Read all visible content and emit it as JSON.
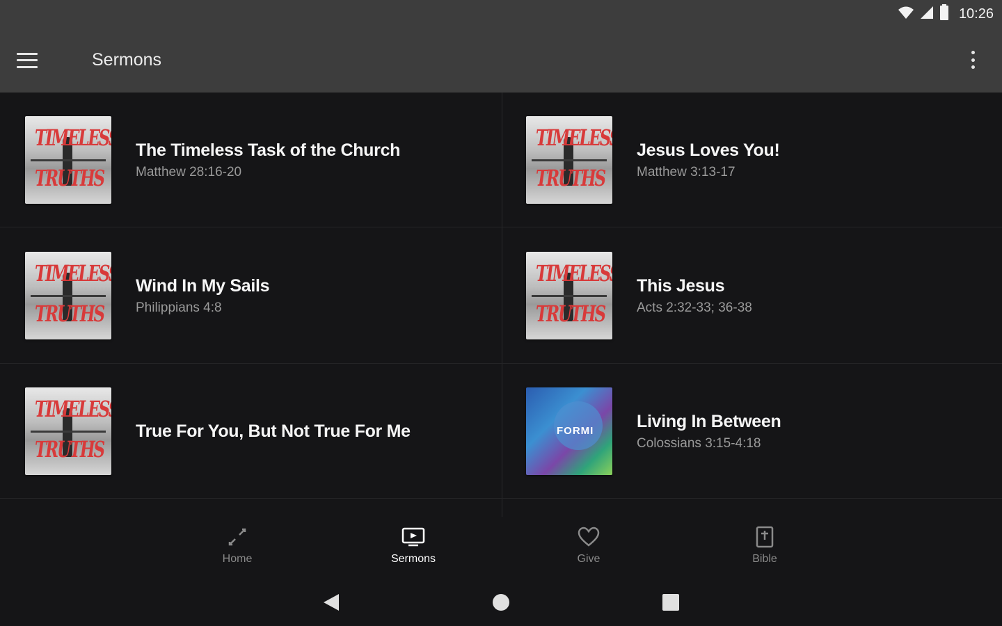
{
  "status": {
    "time": "10:26",
    "icons": [
      "wifi-icon",
      "signal-icon",
      "battery-icon"
    ]
  },
  "appbar": {
    "title": "Sermons",
    "menu_icon": "menu-icon",
    "overflow_icon": "more-vert-icon"
  },
  "sermons": [
    {
      "title": "The Timeless Task of the Church",
      "reference": "Matthew 28:16-20",
      "artwork": "timeless-truths"
    },
    {
      "title": "Jesus Loves You!",
      "reference": "Matthew 3:13-17",
      "artwork": "timeless-truths"
    },
    {
      "title": "Wind In My Sails",
      "reference": "Philippians 4:8",
      "artwork": "timeless-truths"
    },
    {
      "title": "This Jesus",
      "reference": "Acts 2:32-33; 36-38",
      "artwork": "timeless-truths"
    },
    {
      "title": "True For You, But Not True For Me",
      "reference": "",
      "artwork": "timeless-truths"
    },
    {
      "title": "Living In Between",
      "reference": "Colossians 3:15-4:18",
      "artwork": "formed"
    }
  ],
  "artwork_text": {
    "timeless_top": "TIMELESS",
    "timeless_bottom": "TRUTHS",
    "formed": "FORMI"
  },
  "bottom_nav": [
    {
      "label": "Home",
      "icon": "home-icon",
      "active": false
    },
    {
      "label": "Sermons",
      "icon": "tv-play-icon",
      "active": true
    },
    {
      "label": "Give",
      "icon": "heart-icon",
      "active": false
    },
    {
      "label": "Bible",
      "icon": "bible-icon",
      "active": false
    }
  ],
  "system_nav": [
    "back-icon",
    "home-circle-icon",
    "recents-icon"
  ],
  "colors": {
    "background": "#151517",
    "appbar": "#3d3d3d",
    "accent_red": "#d83a3a"
  }
}
